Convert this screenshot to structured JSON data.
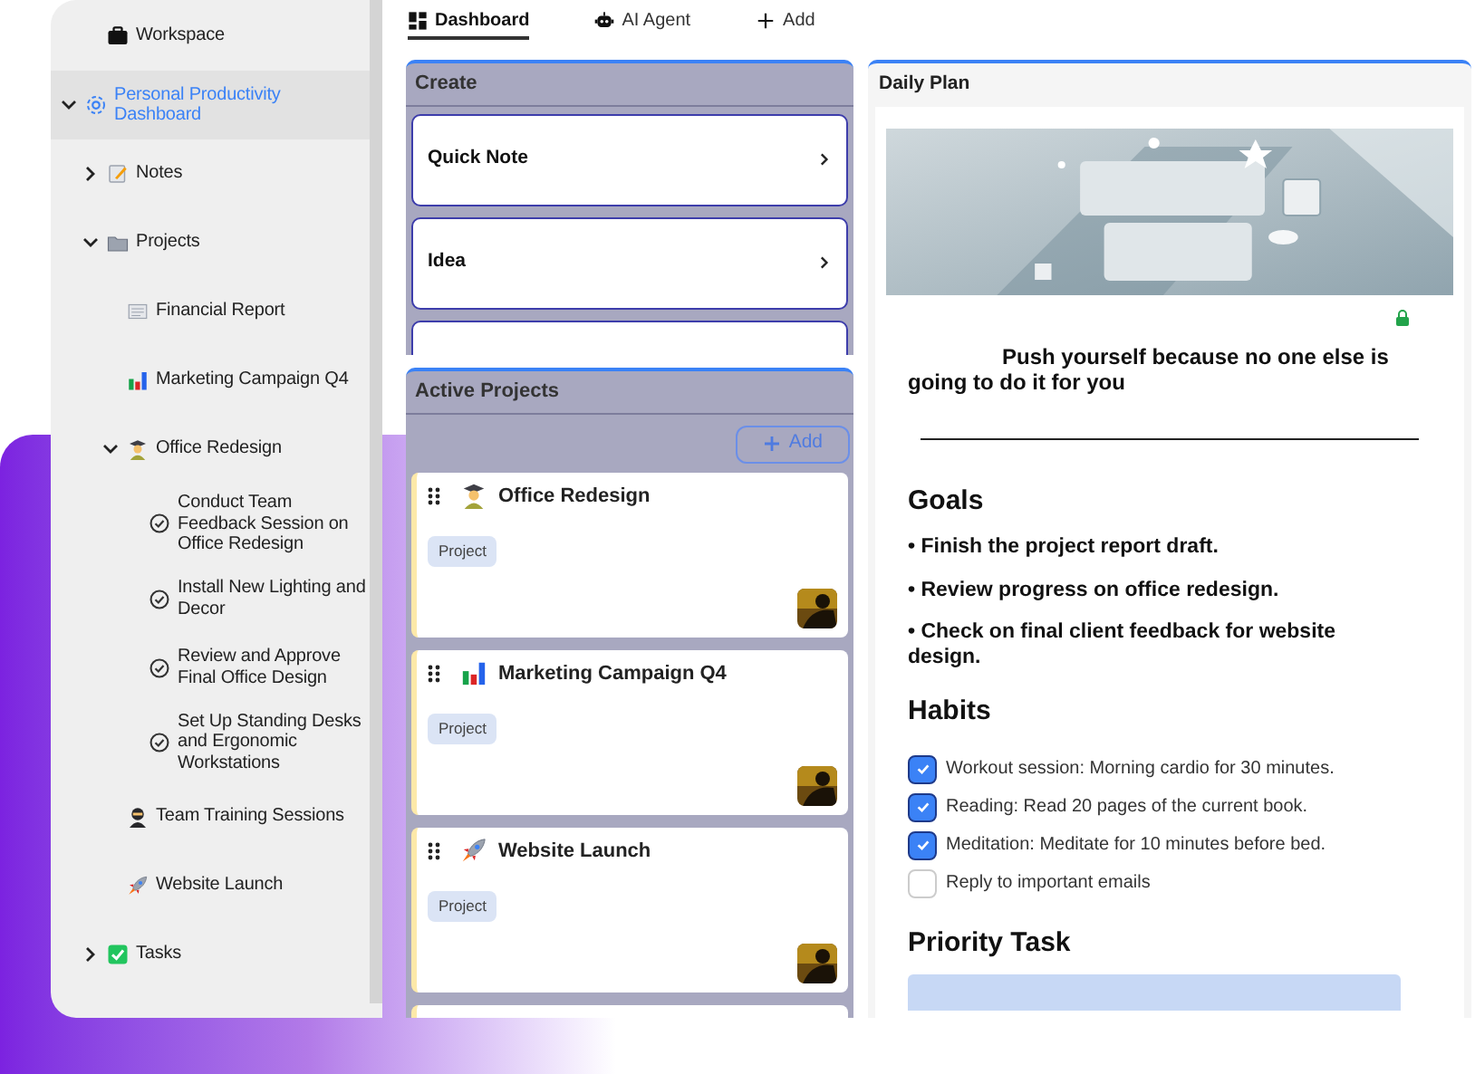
{
  "sidebar": {
    "items": [
      {
        "label": "Workspace",
        "kind": "workspace"
      },
      {
        "label": "Personal Productivity Dashboard",
        "kind": "dashboard",
        "selected": true,
        "expanded": true,
        "children": [
          {
            "label": "Notes",
            "kind": "notes",
            "selected": false,
            "expanded": false
          },
          {
            "label": "Projects",
            "kind": "folder",
            "selected": false,
            "expanded": true,
            "children": [
              {
                "label": "Financial Report",
                "kind": "document",
                "selected": false
              },
              {
                "label": "Marketing Campaign Q4",
                "kind": "chart",
                "selected": false
              },
              {
                "label": "Office Redesign",
                "kind": "person",
                "selected": false,
                "expanded": true,
                "children": [
                  {
                    "label": "Conduct Team Feedback Session on Office Redesign",
                    "kind": "task",
                    "selected": false
                  },
                  {
                    "label": "Install New Lighting and Decor",
                    "kind": "task",
                    "selected": false
                  },
                  {
                    "label": "Review and Approve Final Office Design",
                    "kind": "task",
                    "selected": false
                  },
                  {
                    "label": "Set Up Standing Desks and Ergonomic Workstations",
                    "kind": "task",
                    "selected": false
                  }
                ]
              },
              {
                "label": "Team Training Sessions",
                "kind": "ninja",
                "selected": false
              },
              {
                "label": "Website Launch",
                "kind": "rocket",
                "selected": false
              }
            ]
          },
          {
            "label": "Tasks",
            "kind": "checkmark",
            "selected": false,
            "expanded": false
          }
        ]
      }
    ]
  },
  "tabs": [
    {
      "label": "Dashboard",
      "kind": "grid",
      "selected": true
    },
    {
      "label": "AI Agent",
      "kind": "robot",
      "selected": false
    },
    {
      "label": "Add",
      "kind": "plus",
      "selected": false
    }
  ],
  "create": {
    "title": "Create",
    "items": [
      {
        "label": "Quick Note"
      },
      {
        "label": "Idea"
      }
    ]
  },
  "active_projects": {
    "title": "Active Projects",
    "add_button": "Add",
    "projects": [
      {
        "title": "Office Redesign",
        "kind": "person",
        "tag": "Project"
      },
      {
        "title": "Marketing Campaign Q4",
        "kind": "chart",
        "tag": "Project"
      },
      {
        "title": "Website Launch",
        "kind": "rocket",
        "tag": "Project"
      }
    ]
  },
  "daily_plan": {
    "title": "Daily Plan",
    "banner": {
      "kind": "picture"
    },
    "quote": "Push yourself because no one else is going to do it for you",
    "goals_heading": "Goals",
    "goals": [
      "• Finish the project report draft.",
      "• Review progress on office redesign.",
      "• Check on final client feedback for website design."
    ],
    "habits_heading": "Habits",
    "habits": [
      {
        "label": "Workout session: Morning cardio for 30 minutes.",
        "checked": true
      },
      {
        "label": "Reading: Read 20 pages of the current book.",
        "checked": true
      },
      {
        "label": "Meditation: Meditate for 10 minutes before bed.",
        "checked": true
      },
      {
        "label": "Reply to important emails",
        "checked": false
      }
    ],
    "priority_heading": "Priority Task"
  }
}
